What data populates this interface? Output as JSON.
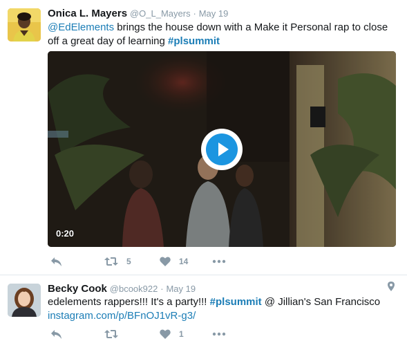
{
  "tweets": [
    {
      "fullname": "Onica L. Mayers",
      "username": "@O_L_Mayers",
      "separator": "·",
      "time": "May 19",
      "text_parts": {
        "mention": "@EdElements",
        "body": " brings the house down with a Make it Personal rap to close off a great day of learning ",
        "hashtag": "#plsummit"
      },
      "video": {
        "duration": "0:20"
      },
      "actions": {
        "reply_icon": "reply-icon",
        "retweet_count": "5",
        "like_count": "14",
        "more_icon": "more-icon"
      }
    },
    {
      "fullname": "Becky Cook",
      "username": "@bcook922",
      "separator": "·",
      "time": "May 19",
      "text_parts": {
        "body": "edelements rappers!!! It's a party!!! ",
        "hashtag": "#plsummit",
        "location": " @ Jillian's San Francisco",
        "url": "instagram.com/p/BFnOJ1vR-g3/"
      },
      "actions": {
        "reply_icon": "reply-icon",
        "retweet_count": "",
        "like_count": "1",
        "more_icon": "more-icon"
      }
    }
  ],
  "colors": {
    "link": "#1b7db6",
    "muted": "#8899a6",
    "play": "#1b95e0",
    "divider": "#e1e8ed"
  }
}
